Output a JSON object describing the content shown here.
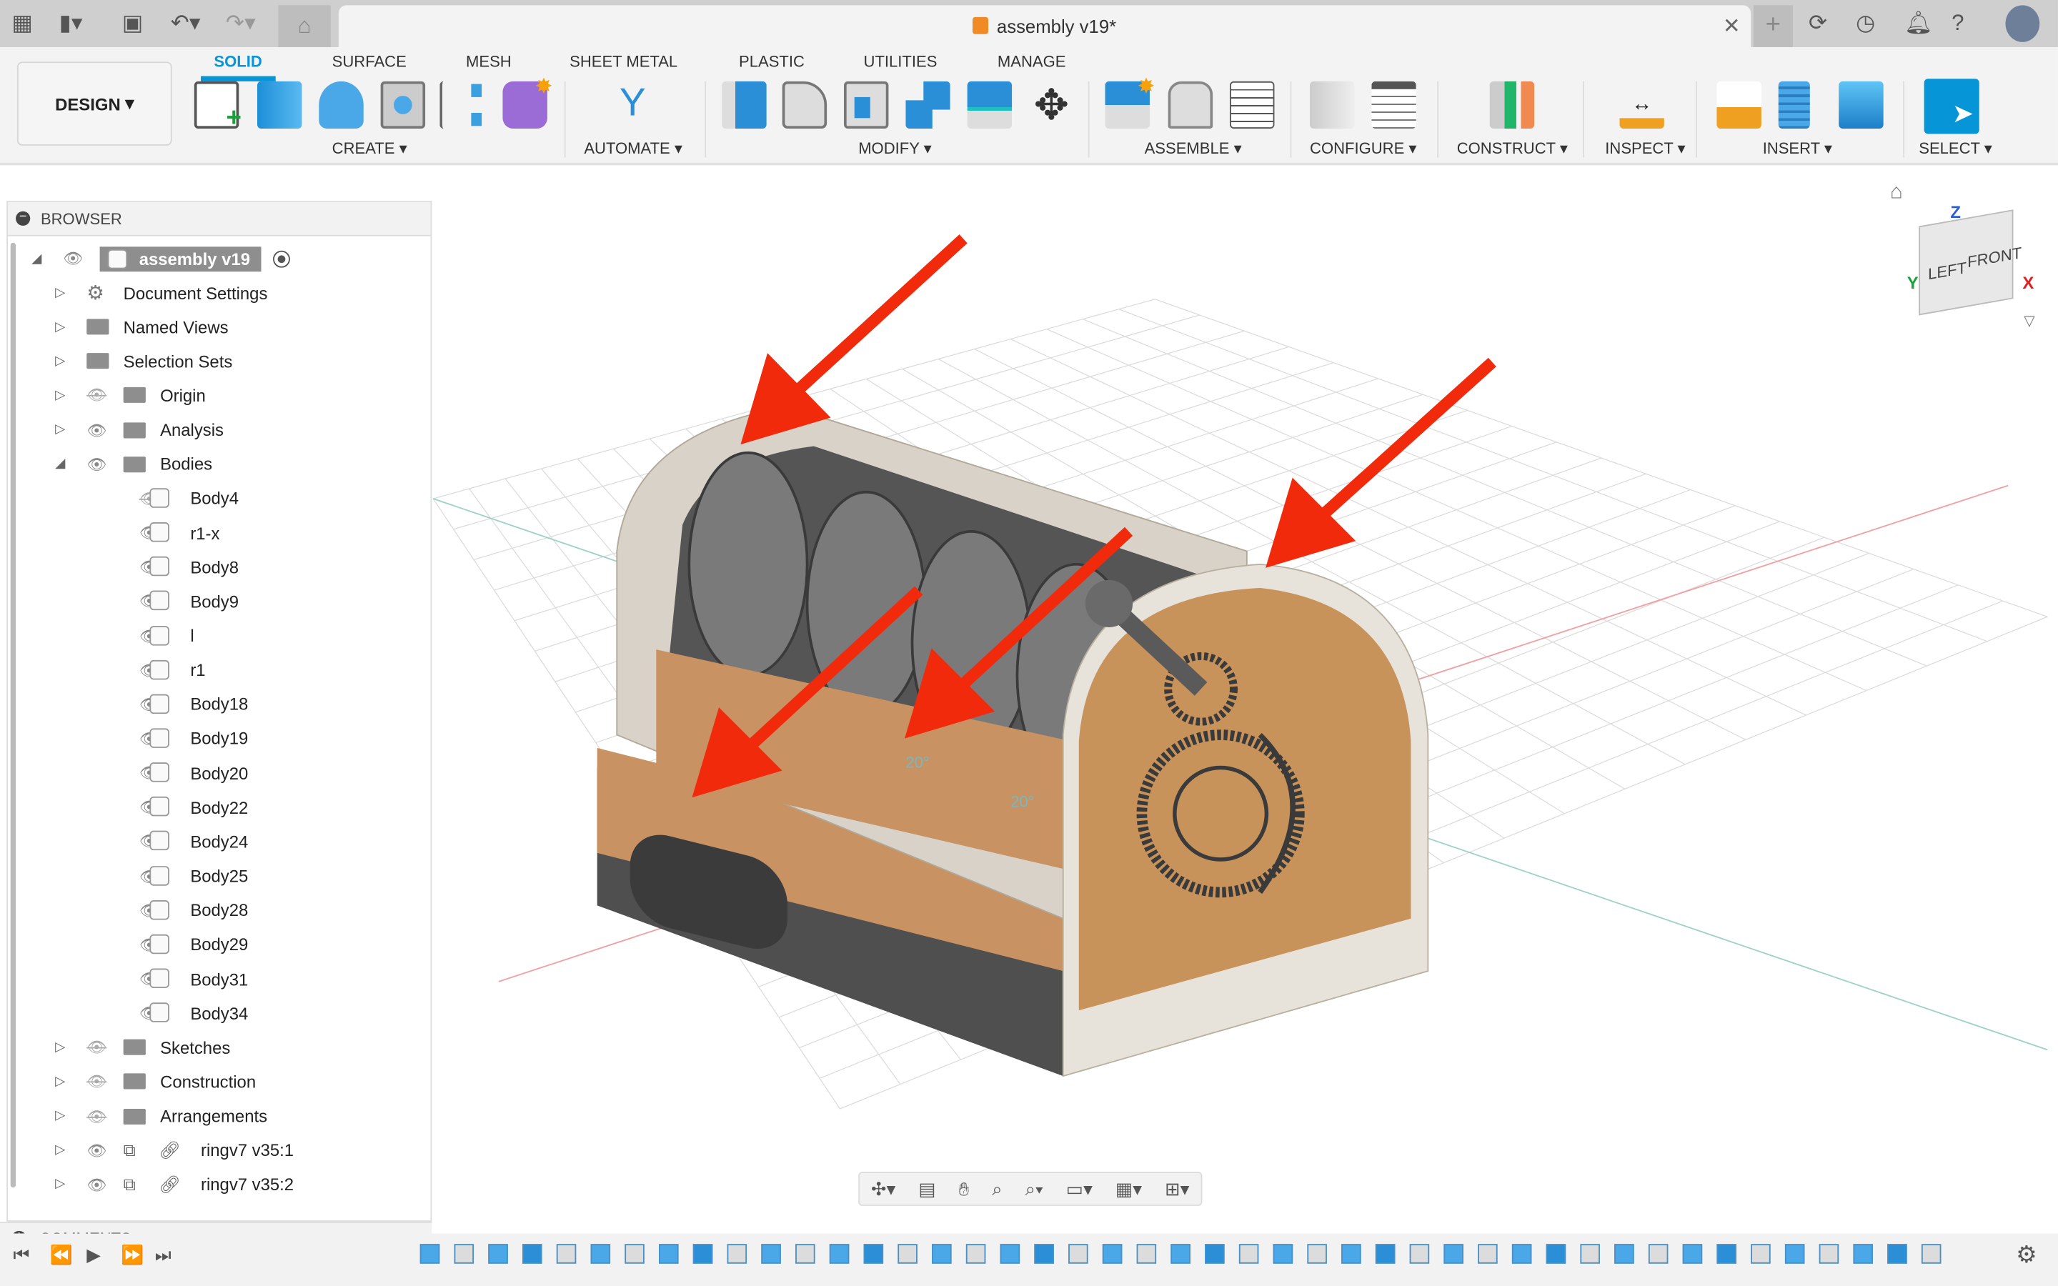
{
  "titlebar": {
    "doc_title": "assembly v19*",
    "icons": [
      "apps-grid-icon",
      "file-icon",
      "save-icon",
      "undo-icon",
      "redo-icon",
      "home-icon",
      "new-tab-icon",
      "extensions-icon",
      "job-status-icon",
      "notifications-icon",
      "help-icon",
      "profile-avatar"
    ]
  },
  "ribbon": {
    "workspace": "DESIGN",
    "tabs": [
      "SOLID",
      "SURFACE",
      "MESH",
      "SHEET METAL",
      "PLASTIC",
      "UTILITIES",
      "MANAGE"
    ],
    "active_tab": "SOLID",
    "groups": [
      "CREATE",
      "AUTOMATE",
      "MODIFY",
      "ASSEMBLE",
      "CONFIGURE",
      "CONSTRUCT",
      "INSPECT",
      "INSERT",
      "SELECT"
    ]
  },
  "browser": {
    "title": "BROWSER",
    "root": "assembly v19",
    "items": [
      {
        "label": "Document Settings",
        "type": "gear",
        "level": 1,
        "expand": "collapsed",
        "eye": ""
      },
      {
        "label": "Named Views",
        "type": "folder",
        "level": 1,
        "expand": "collapsed",
        "eye": ""
      },
      {
        "label": "Selection Sets",
        "type": "folder",
        "level": 1,
        "expand": "collapsed",
        "eye": ""
      },
      {
        "label": "Origin",
        "type": "folder",
        "level": 1,
        "expand": "collapsed",
        "eye": "hidden"
      },
      {
        "label": "Analysis",
        "type": "folder",
        "level": 1,
        "expand": "collapsed",
        "eye": "visible"
      },
      {
        "label": "Bodies",
        "type": "folder",
        "level": 1,
        "expand": "expanded",
        "eye": "visible"
      },
      {
        "label": "Body4",
        "type": "body",
        "level": 2,
        "eye": "hidden"
      },
      {
        "label": "r1-x",
        "type": "body",
        "level": 2,
        "eye": "visible"
      },
      {
        "label": "Body8",
        "type": "body",
        "level": 2,
        "eye": "visible"
      },
      {
        "label": "Body9",
        "type": "body",
        "level": 2,
        "eye": "visible"
      },
      {
        "label": "l",
        "type": "body",
        "level": 2,
        "eye": "visible"
      },
      {
        "label": "r1",
        "type": "body",
        "level": 2,
        "eye": "visible"
      },
      {
        "label": "Body18",
        "type": "body",
        "level": 2,
        "eye": "visible"
      },
      {
        "label": "Body19",
        "type": "body",
        "level": 2,
        "eye": "visible"
      },
      {
        "label": "Body20",
        "type": "body",
        "level": 2,
        "eye": "visible"
      },
      {
        "label": "Body22",
        "type": "body",
        "level": 2,
        "eye": "visible"
      },
      {
        "label": "Body24",
        "type": "body",
        "level": 2,
        "eye": "visible"
      },
      {
        "label": "Body25",
        "type": "body",
        "level": 2,
        "eye": "visible"
      },
      {
        "label": "Body28",
        "type": "body",
        "level": 2,
        "eye": "visible"
      },
      {
        "label": "Body29",
        "type": "body",
        "level": 2,
        "eye": "visible"
      },
      {
        "label": "Body31",
        "type": "body",
        "level": 2,
        "eye": "visible"
      },
      {
        "label": "Body34",
        "type": "body",
        "level": 2,
        "eye": "visible"
      },
      {
        "label": "Sketches",
        "type": "folder",
        "level": 1,
        "expand": "collapsed",
        "eye": "hidden"
      },
      {
        "label": "Construction",
        "type": "folder",
        "level": 1,
        "expand": "collapsed",
        "eye": "hidden"
      },
      {
        "label": "Arrangements",
        "type": "folder",
        "level": 1,
        "expand": "collapsed",
        "eye": "hidden"
      },
      {
        "label": "ringv7 v35:1",
        "type": "component",
        "level": 1,
        "expand": "collapsed",
        "eye": "visible"
      },
      {
        "label": "ringv7 v35:2",
        "type": "component",
        "level": 1,
        "expand": "collapsed",
        "eye": "visible"
      }
    ]
  },
  "comments": {
    "title": "COMMENTS"
  },
  "viewcube": {
    "top": "Z",
    "left_face": "LEFT",
    "front_face": "FRONT",
    "x": "X",
    "y": "Y"
  },
  "canvas": {
    "angle_labels": [
      "20°",
      "20°"
    ]
  },
  "colors": {
    "accent": "#0696d7",
    "arrow": "#f22a0c",
    "wood": "#c8935a",
    "base": "#5b5b5b"
  }
}
